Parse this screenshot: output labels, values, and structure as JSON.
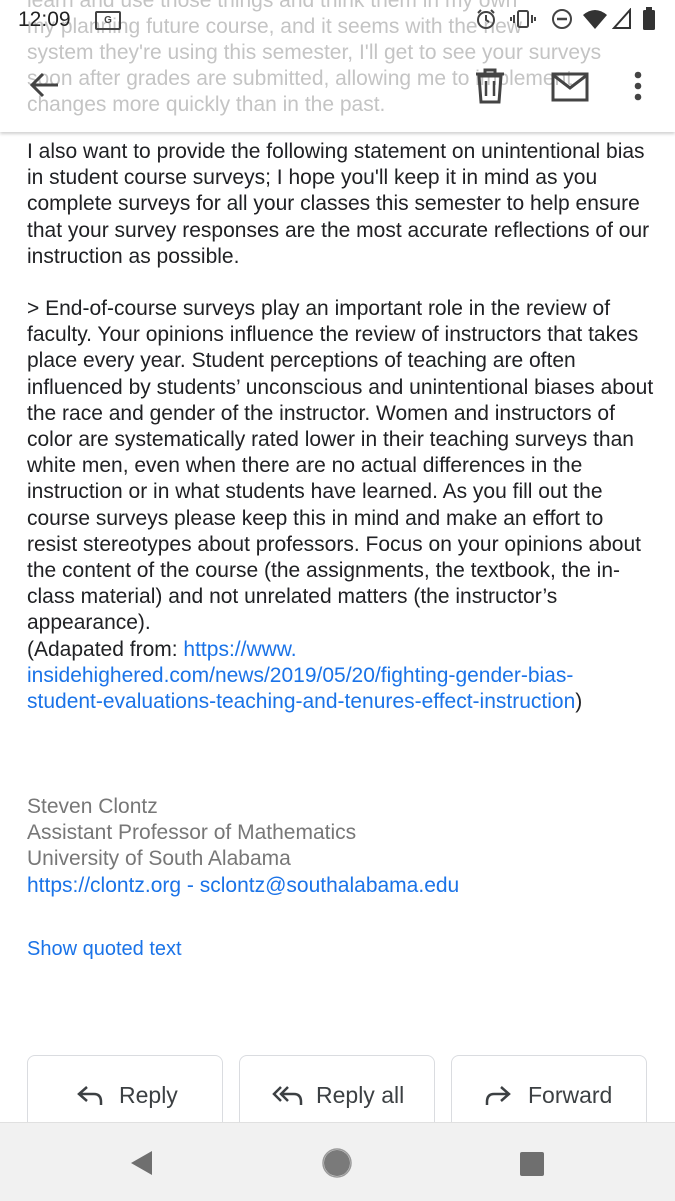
{
  "status_bar": {
    "time": "12:09",
    "badge": "G"
  },
  "overflow_preview_lines": "learn and use those things and think them in my own\nmy planning future course, and it seems with the new\nsystem they're using this semester, I'll get to see your surveys\nsoon after grades are submitted, allowing me to implement\nchanges more quickly than in the past.",
  "toolbar": {
    "back_icon": "arrow-left-icon",
    "delete_icon": "trash-icon",
    "mark_unread_icon": "envelope-icon",
    "more_icon": "more-vert-icon"
  },
  "email": {
    "paragraph1": "I also want to provide the following statement on unintentional bias in student course surveys; I hope you'll keep it in mind as you complete surveys for all your classes this semester to help ensure that your survey responses are the most accurate reflections of our instruction as possible.",
    "quote": "> End-of-course surveys play an important role in the review of faculty. Your opinions influence the review of instructors that takes place every year. Student perceptions of teaching are often influenced by students’ unconscious and unintentional biases about the race and gender of the instructor. Women and instructors of color are systematically rated lower in their teaching surveys than white men, even when there are no actual differences in the instruction or in what students have learned. As you fill out the course surveys please keep this in mind and make an effort to resist stereotypes about professors. Focus on your opinions about the content of the course (the assignments, the textbook, the in-class material) and not unrelated matters (the instructor’s appearance).",
    "adapted_prefix": "(Adapated from: ",
    "adapted_link_line1": "https://www.",
    "adapted_link_line2": "insidehighered.com/news/2019/05/20/fighting-gender-bias-",
    "adapted_link_line3": "student-evaluations-teaching-and-tenures-effect-instruction",
    "adapted_suffix": ")"
  },
  "signature": {
    "name": "Steven Clontz",
    "title": "Assistant Professor of Mathematics",
    "org": "University of South Alabama",
    "website": "https://clontz.org",
    "separator": " - ",
    "email": "sclontz@southalabama.edu"
  },
  "show_quoted_label": "Show quoted text",
  "actions": {
    "reply": "Reply",
    "reply_all": "Reply all",
    "forward": "Forward"
  },
  "colors": {
    "link": "#1a73e8",
    "signature": "#777777",
    "text": "#202124"
  }
}
